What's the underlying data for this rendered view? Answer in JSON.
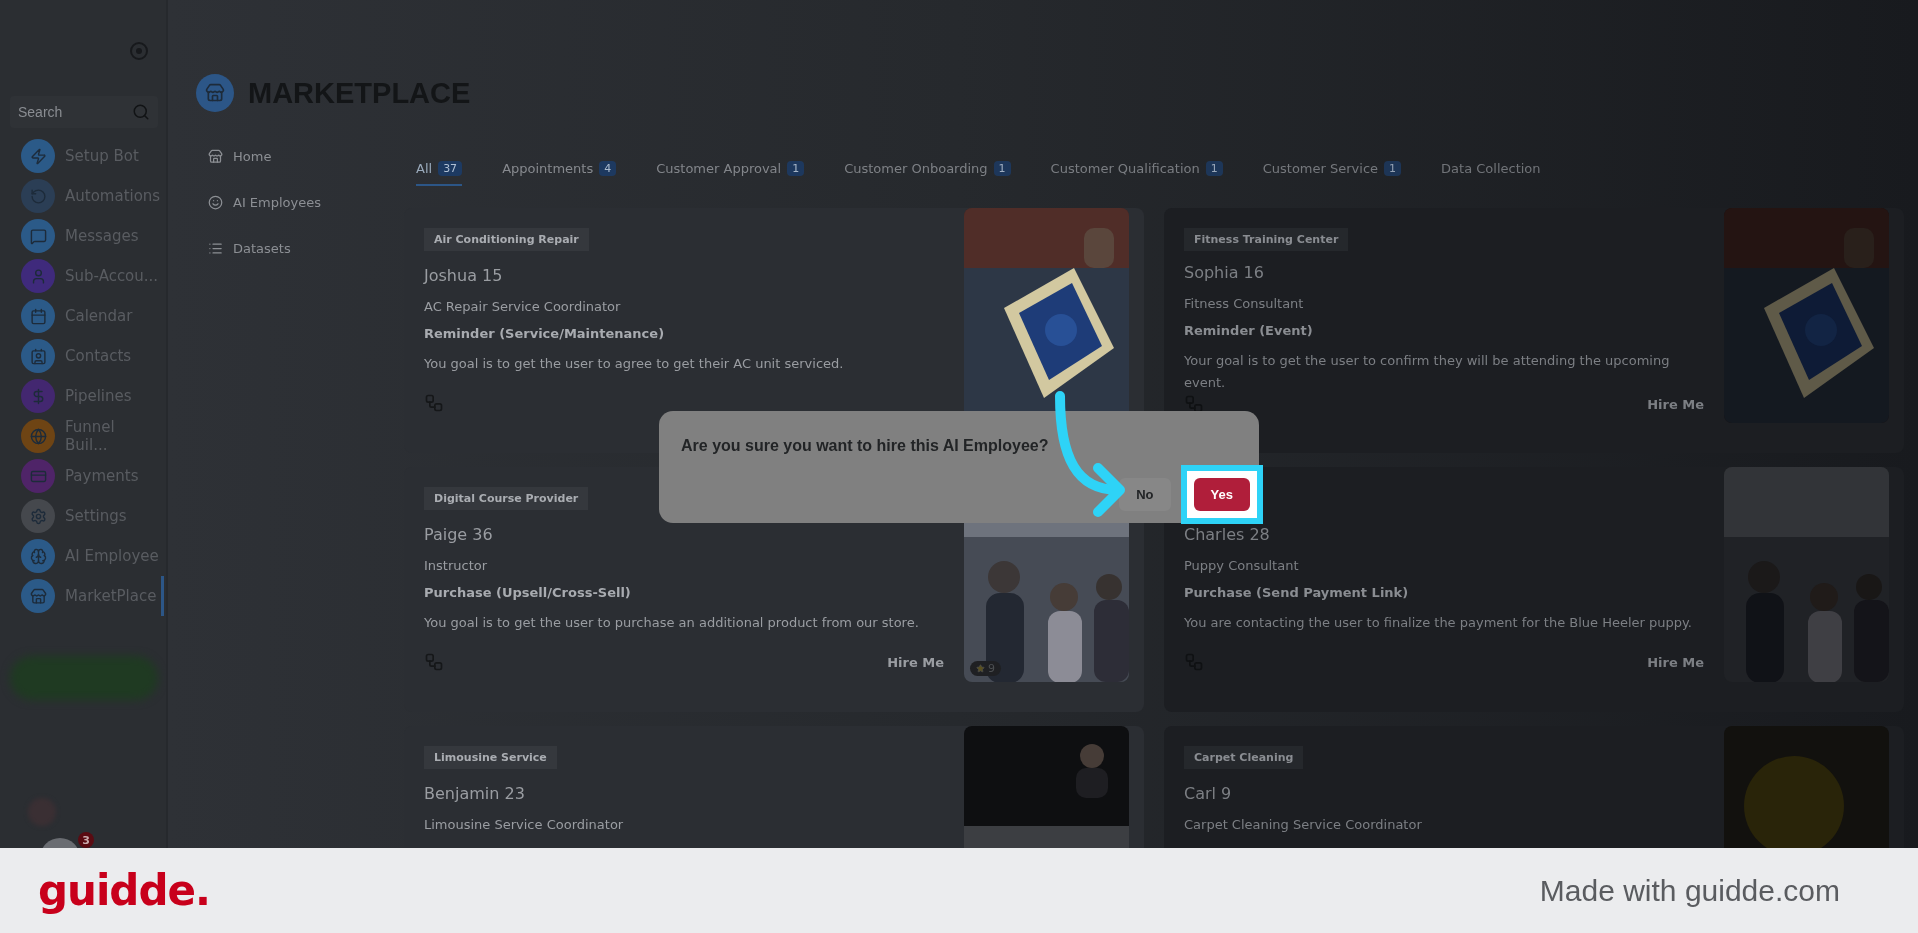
{
  "sidebar": {
    "search": {
      "placeholder": "Search"
    },
    "items": [
      {
        "label": "Setup Bot",
        "selected": false
      },
      {
        "label": "Automations",
        "selected": false
      },
      {
        "label": "Messages",
        "selected": false
      },
      {
        "label": "Sub-Accou...",
        "selected": false
      },
      {
        "label": "Calendar",
        "selected": false
      },
      {
        "label": "Contacts",
        "selected": false
      },
      {
        "label": "Pipelines",
        "selected": false
      },
      {
        "label": "Funnel Buil...",
        "selected": false
      },
      {
        "label": "Payments",
        "selected": false
      },
      {
        "label": "Settings",
        "selected": false
      },
      {
        "label": "AI Employee",
        "selected": false
      },
      {
        "label": "MarketPlace",
        "selected": true
      }
    ],
    "notification_badge": "3"
  },
  "header": {
    "title": "MARKETPLACE"
  },
  "submenu": [
    "Home",
    "AI Employees",
    "Datasets"
  ],
  "tabs": [
    {
      "label": "All",
      "count": "37",
      "selected": true
    },
    {
      "label": "Appointments",
      "count": "4",
      "selected": false
    },
    {
      "label": "Customer Approval",
      "count": "1",
      "selected": false
    },
    {
      "label": "Customer Onboarding",
      "count": "1",
      "selected": false
    },
    {
      "label": "Customer Qualification",
      "count": "1",
      "selected": false
    },
    {
      "label": "Customer Service",
      "count": "1",
      "selected": false
    },
    {
      "label": "Data Collection",
      "selected": false
    }
  ],
  "cards": [
    {
      "category": "Air Conditioning Repair",
      "name": "Joshua 15",
      "role": "AC Repair Service Coordinator",
      "goal": "Reminder (Service/Maintenance)",
      "description": "You goal is to get the user to agree to get their AC unit serviced."
    },
    {
      "category": "Fitness Training Center",
      "name": "Sophia 16",
      "role": "Fitness Consultant",
      "goal": "Reminder (Event)",
      "description": "Your goal is to get the user to confirm they will be attending the upcoming event.",
      "action": "Hire Me"
    },
    {
      "category": "Digital Course Provider",
      "name": "Paige 36",
      "role": "Instructor",
      "goal": "Purchase (Upsell/Cross-Sell)",
      "description": "You goal is to get the user to purchase an additional product from our store.",
      "action": "Hire Me",
      "likes": "9"
    },
    {
      "name": "Charles 28",
      "role": "Puppy Consultant",
      "goal": "Purchase (Send Payment Link)",
      "description": "You are contacting the user to finalize the payment for the Blue Heeler puppy.",
      "action": "Hire Me"
    },
    {
      "category": "Limousine Service",
      "name": "Benjamin 23",
      "role": "Limousine Service Coordinator"
    },
    {
      "category": "Carpet Cleaning",
      "name": "Carl 9",
      "role": "Carpet Cleaning Service Coordinator"
    }
  ],
  "dialog": {
    "message": "Are you sure you want to hire this AI Employee?",
    "buttons": [
      {
        "label": "No",
        "kind": "secondary",
        "highlighted": false
      },
      {
        "label": "Yes",
        "kind": "primary",
        "highlighted": true
      }
    ]
  },
  "footer": {
    "logo": "guidde.",
    "credit": "Made with guidde.com"
  }
}
